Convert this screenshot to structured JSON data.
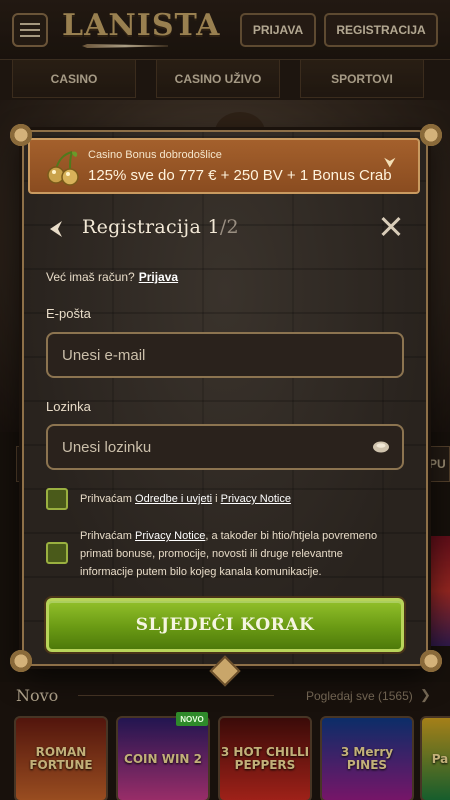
{
  "header": {
    "logo_text": "LANISTA",
    "login_label": "PRIJAVA",
    "register_label": "REGISTRACIJA"
  },
  "nav": {
    "tabs": [
      {
        "label": "CASINO"
      },
      {
        "label": "CASINO UŽIVO"
      },
      {
        "label": "SPORTOVI"
      }
    ]
  },
  "bonus": {
    "subtitle": "Casino Bonus dobrodošlice",
    "offer": "125% sve do 777 € + 250 BV + 1 Bonus Crab",
    "icon": "cherry-icon"
  },
  "modal": {
    "title": "Registracija 1",
    "title_total": "/2",
    "have_account_text": "Već imaš račun?",
    "login_link": "Prijava",
    "email_label": "E-pošta",
    "email_placeholder": "Unesi e-mail",
    "password_label": "Lozinka",
    "password_placeholder": "Unesi lozinku",
    "terms": {
      "prefix": "Prihvaćam",
      "link1": "Odredbe i uvjeti",
      "joiner": "i",
      "link2": "Privacy Notice"
    },
    "marketing": {
      "prefix": "Prihvaćam",
      "link": "Privacy Notice",
      "rest": ", a također bi htio/htjela povremeno primati bonuse, promocije, novosti ili druge relevantne informacije putem bilo kojeg kanala komunikacije."
    },
    "cta_label": "SLJEDEĆI KORAK"
  },
  "background": {
    "strip_right_text": "PU"
  },
  "novo": {
    "title": "Novo",
    "see_all": "Pogledaj sve (1565)",
    "badge": "NOVO",
    "games": [
      {
        "label": "ROMAN FORTUNE"
      },
      {
        "label": "COIN WIN 2"
      },
      {
        "label": "3 HOT CHILLI PEPPERS"
      },
      {
        "label": "3 Merry PINES"
      },
      {
        "label": "Pa"
      }
    ]
  },
  "colors": {
    "accent_gold": "#8e7048",
    "cta_green": "#6a9a14",
    "banner_orange": "#a4602c"
  }
}
